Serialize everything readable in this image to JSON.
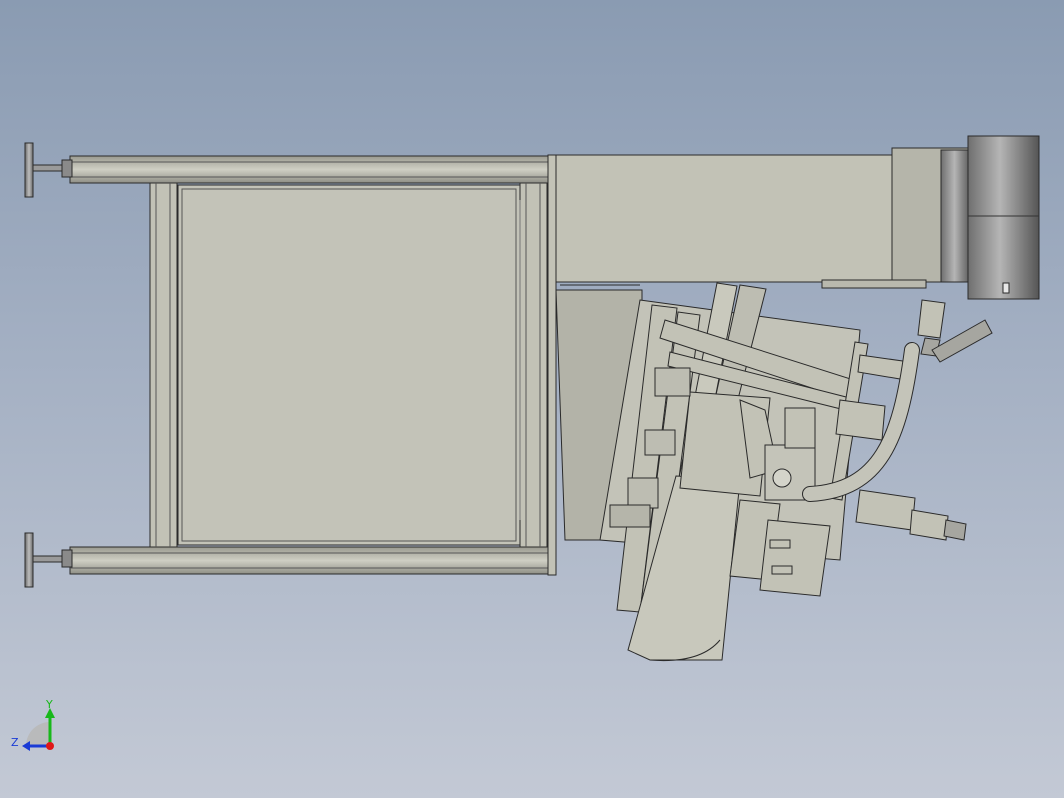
{
  "view": {
    "background_top": "#8a9bb2",
    "background_bottom": "#c3c9d5",
    "part_fill": "#c2c2b6",
    "part_fill_dark": "#a9a99d",
    "edge_color": "#2a2a2a"
  },
  "triad": {
    "y_label": "Y",
    "z_label": "Z",
    "y_color": "#18b81a",
    "z_color": "#1a3bd6",
    "x_color": "#e01818"
  }
}
